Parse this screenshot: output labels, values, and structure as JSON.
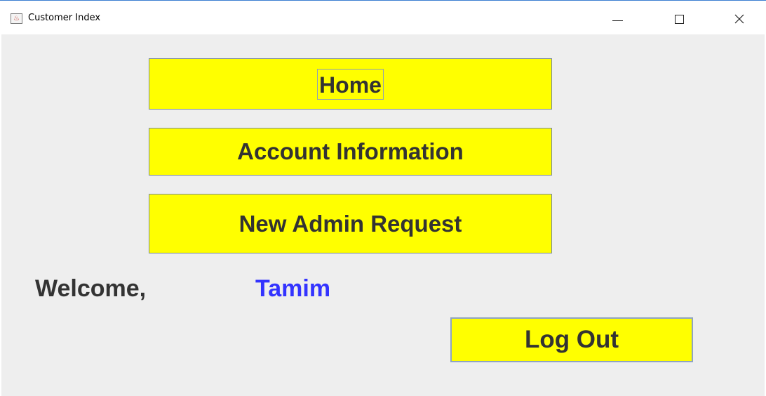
{
  "window": {
    "title": "Customer Index",
    "app_icon": "java-icon",
    "controls": [
      "minimize-icon",
      "maximize-icon",
      "close-icon"
    ]
  },
  "menu": {
    "home_label": "Home",
    "account_label": "Account Information",
    "admin_request_label": "New Admin Request"
  },
  "welcome": {
    "label": "Welcome,",
    "username": "Tamim"
  },
  "logout_label": "Log Out",
  "colors": {
    "button_bg": "#ffff00",
    "button_text": "#333333",
    "username_text": "#3333ff",
    "panel_bg": "#eeeeee"
  }
}
